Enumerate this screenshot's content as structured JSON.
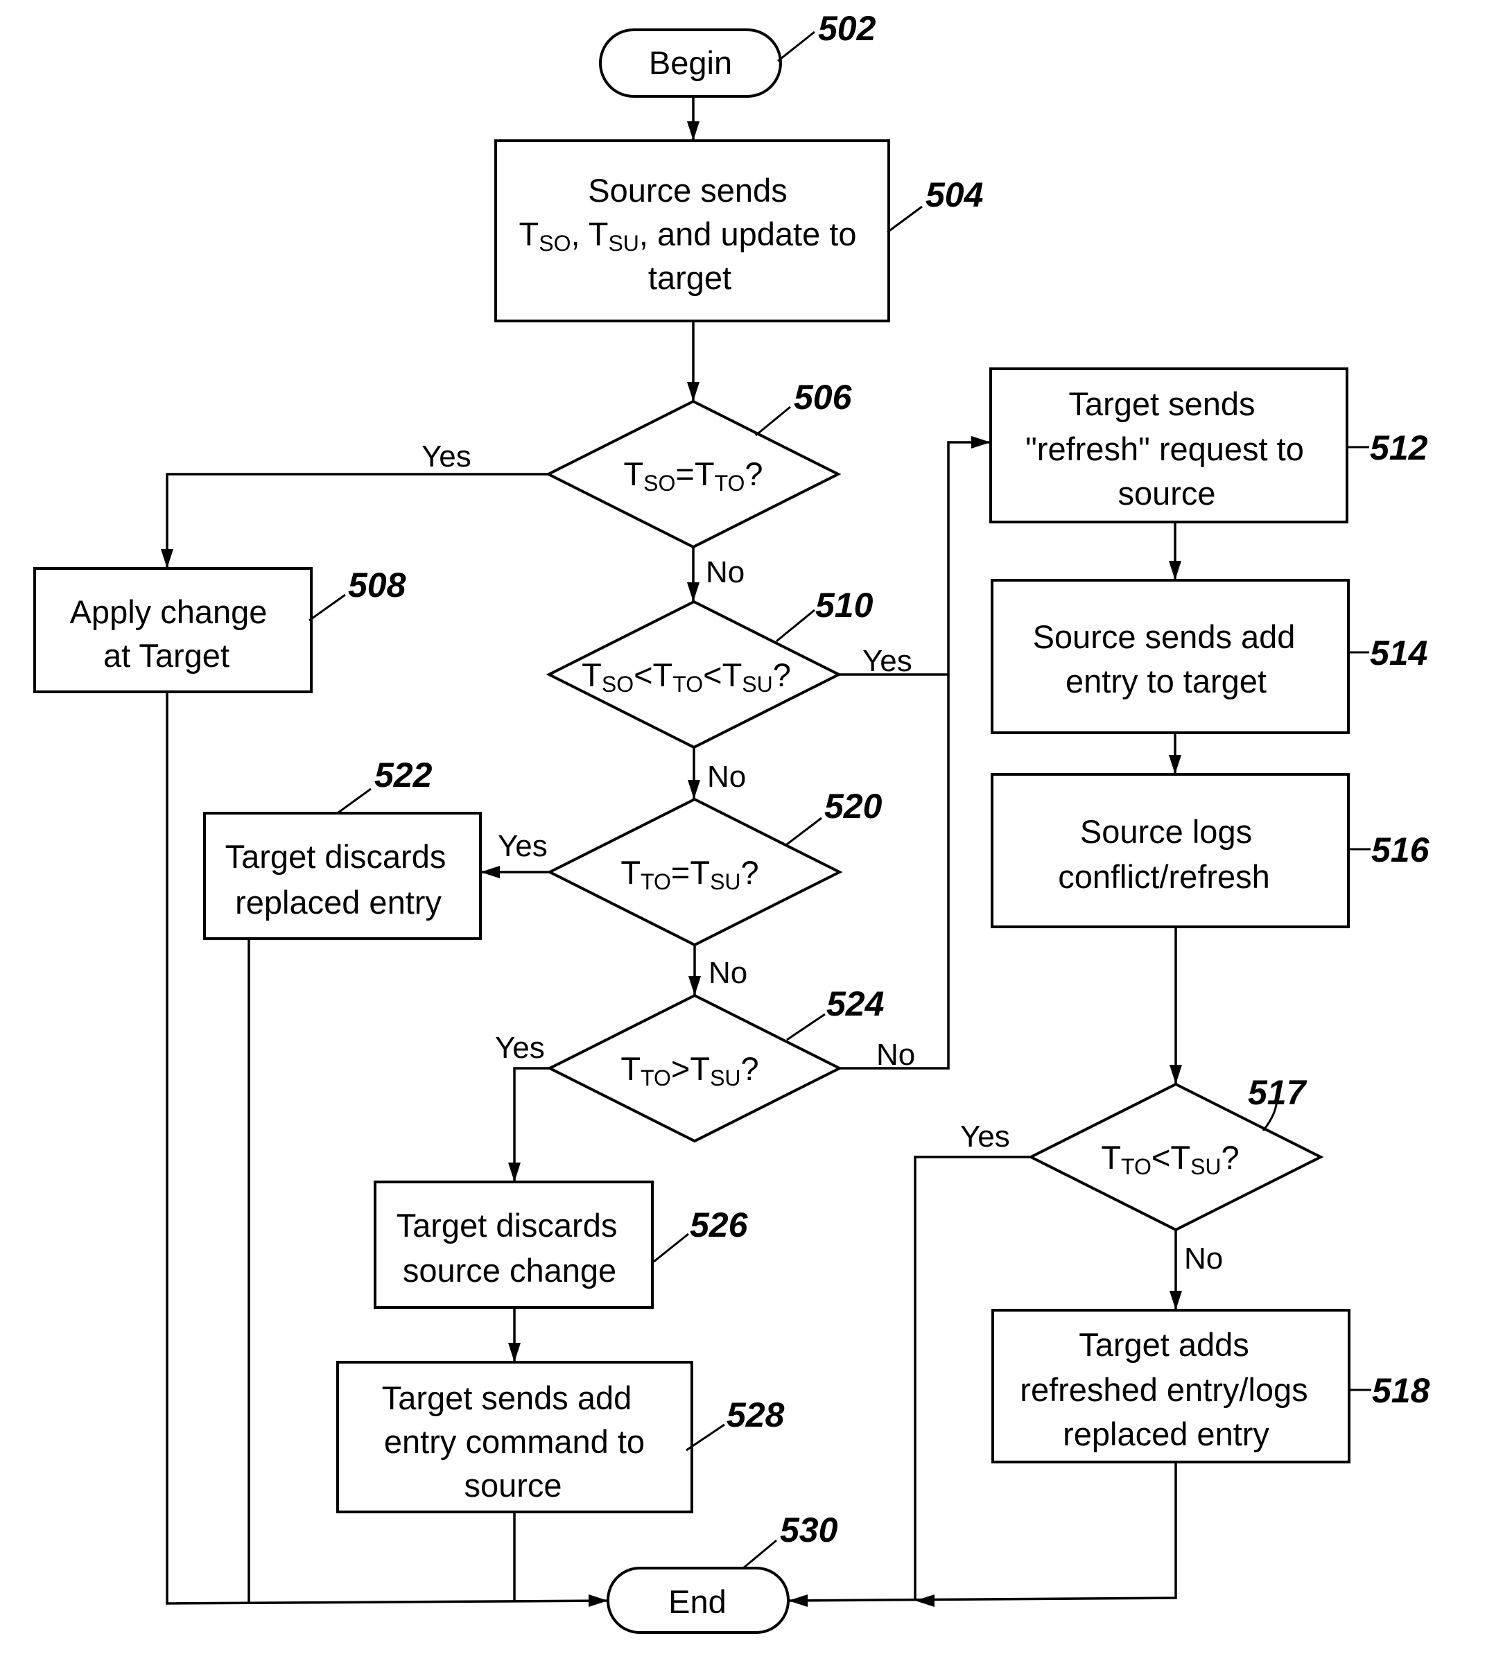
{
  "figure": {
    "nodes": {
      "begin": {
        "ref": "502",
        "text": "Begin"
      },
      "n504": {
        "ref": "504",
        "lines": [
          "Source sends",
          "",
          "target"
        ],
        "line2": {
          "t1": "T",
          "s1": "SO",
          "mid": ", T",
          "s2": "SU",
          "tail": ", and update to"
        }
      },
      "n506": {
        "ref": "506",
        "cond": {
          "a": "T",
          "as": "SO",
          "op": "=",
          "b": "T",
          "bs": "TO",
          "q": "?"
        }
      },
      "n508": {
        "ref": "508",
        "lines": [
          "Apply change",
          "at Target"
        ]
      },
      "n510": {
        "ref": "510",
        "cond": {
          "a": "T",
          "as": "SO",
          "op1": "<",
          "b": "T",
          "bs": "TO",
          "op2": "<",
          "c": "T",
          "cs": "SU",
          "q": "?"
        }
      },
      "n512": {
        "ref": "512",
        "lines": [
          "Target sends",
          "\"refresh\" request to",
          "source"
        ]
      },
      "n514": {
        "ref": "514",
        "lines": [
          "Source sends add",
          "entry to target"
        ]
      },
      "n516": {
        "ref": "516",
        "lines": [
          "Source logs",
          "conflict/refresh"
        ]
      },
      "n517": {
        "ref": "517",
        "cond": {
          "a": "T",
          "as": "TO",
          "op": "<",
          "b": "T",
          "bs": "SU",
          "q": "?"
        }
      },
      "n518": {
        "ref": "518",
        "lines": [
          "Target adds",
          "refreshed entry/logs",
          "replaced entry"
        ]
      },
      "n520": {
        "ref": "520",
        "cond": {
          "a": "T",
          "as": "TO",
          "op": "=",
          "b": "T",
          "bs": "SU",
          "q": "?"
        }
      },
      "n522": {
        "ref": "522",
        "lines": [
          "Target discards",
          "replaced entry"
        ]
      },
      "n524": {
        "ref": "524",
        "cond": {
          "a": "T",
          "as": "TO",
          "op": ">",
          "b": "T",
          "bs": "SU",
          "q": "?"
        }
      },
      "n526": {
        "ref": "526",
        "lines": [
          "Target discards",
          "source change"
        ]
      },
      "n528": {
        "ref": "528",
        "lines": [
          "Target sends add",
          "entry command to",
          "source"
        ]
      },
      "end": {
        "ref": "530",
        "text": "End"
      }
    },
    "edge_labels": {
      "yes": "Yes",
      "no": "No"
    }
  }
}
